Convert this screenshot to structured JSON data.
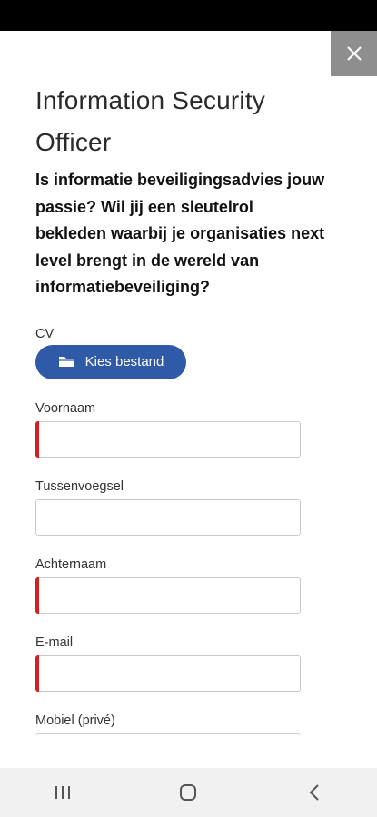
{
  "modal": {
    "close_icon": "close-icon",
    "title": "Information Security Officer",
    "intro": "Is informatie beveiligingsadvies jouw passie? Wil jij een sleutelrol bekleden waarbij je organisaties next level brengt in de wereld van informatiebeveiliging?"
  },
  "form": {
    "cv_label": "CV",
    "file_button": {
      "icon": "folder-icon",
      "label": "Kies bestand"
    },
    "fields": [
      {
        "label": "Voornaam",
        "value": "",
        "required": true
      },
      {
        "label": "Tussenvoegsel",
        "value": "",
        "required": false
      },
      {
        "label": "Achternaam",
        "value": "",
        "required": true
      },
      {
        "label": "E-mail",
        "value": "",
        "required": true
      },
      {
        "label": "Mobiel (privé)",
        "value": "",
        "required": false
      }
    ],
    "required_marker_color": "#d61f1f"
  },
  "colors": {
    "accent": "#2f5aa8",
    "close_bg": "#8e8e8e"
  },
  "navbar": {
    "icons": [
      "recent-apps-icon",
      "home-icon",
      "back-icon"
    ]
  }
}
